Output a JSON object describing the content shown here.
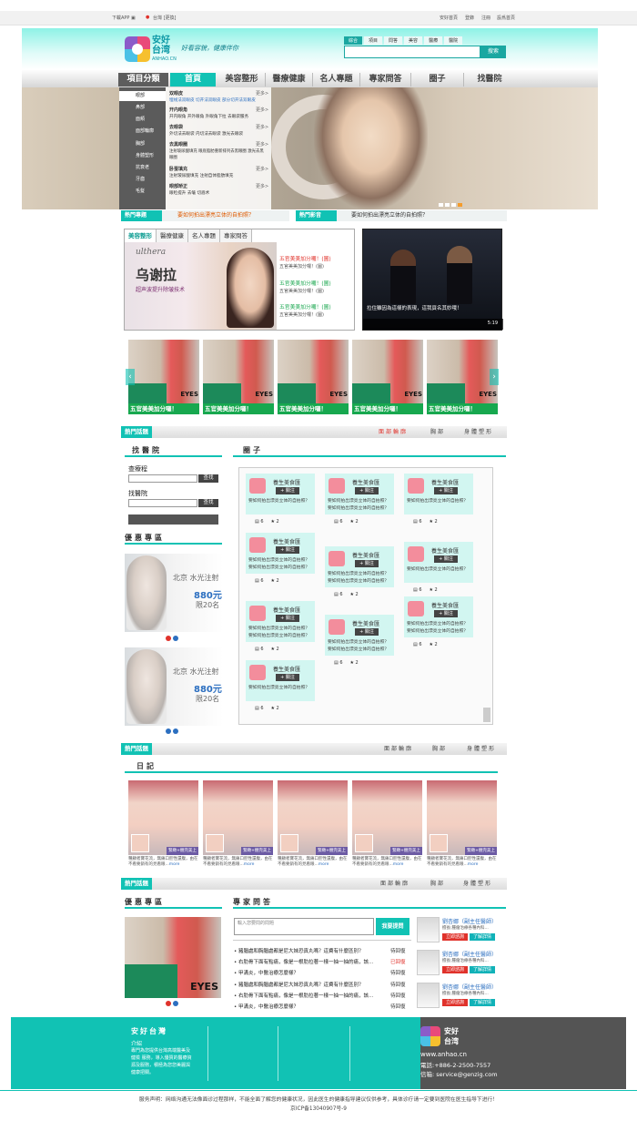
{
  "topbar": {
    "download": "下載APP",
    "location_prefix": "台灣",
    "location": "[更換]",
    "links": [
      "安好首頁",
      "登錄",
      "注冊",
      "設爲首頁"
    ]
  },
  "header": {
    "logo_cn": "安好台湾",
    "logo_cn_1": "安好",
    "logo_cn_2": "台湾",
    "logo_en": "ANHAO.CN",
    "slogan": "好看容貌，健康伴你",
    "search_tabs": [
      "綜合",
      "項目",
      "問答",
      "美容",
      "醫療",
      "醫院"
    ],
    "search_button": "搜索",
    "search_placeholder": ""
  },
  "nav": {
    "category": "項目分類",
    "items": [
      "首頁",
      "美容整形",
      "醫療健康",
      "名人專題",
      "專家問答",
      "圈子",
      "找醫院"
    ]
  },
  "sidebar_menu": {
    "categories": [
      "眼部",
      "鼻部",
      "面頰",
      "面部輪廓",
      "胸部",
      "身體塑形",
      "抗衰老",
      "牙齒",
      "毛髮"
    ],
    "more": "更多>",
    "entries": [
      {
        "title": "双眼皮",
        "desc": "埋线法双眼皮 切开法双眼皮 部分切开法双眼皮"
      },
      {
        "title": "开内眼角",
        "desc": "开内眼角 开外眼角 外眼角下拉 去眼袋服务"
      },
      {
        "title": "去眼袋",
        "desc": "外切法去眼袋 内切法去眼袋 激光去眼袋"
      },
      {
        "title": "去黑眼圈",
        "desc": "注射玻尿酸填充 眼底脂肪重新排列去黑眼圈 激光去黑眼圈"
      },
      {
        "title": "卧蚕填充",
        "desc": "注射玻尿酸填充 注射自体脂肪填充"
      },
      {
        "title": "眼部矫正",
        "desc": "眼睑提升 去皱 切眉术"
      }
    ]
  },
  "hot_bar": [
    {
      "label": "熱門專題",
      "text": "要如何拍出漂亮立体的自拍照？"
    },
    {
      "label": "熱門影音",
      "text": "要如何拍出漂亮立体的自拍照？"
    }
  ],
  "tabs_panel": {
    "tabs": [
      "美容整形",
      "醫療健康",
      "名人專題",
      "專家問答"
    ],
    "ad": {
      "brand": "ulthera",
      "title": "乌谢拉",
      "subtitle": "超声波提升除皱技术"
    },
    "links": [
      {
        "title": "五官美美加分囉！(圖)",
        "sub": "五官美美加分囉！(圖)"
      },
      {
        "title": "五官美美加分囉！(圖)",
        "sub": "五官美美加分囉！(圖)"
      },
      {
        "title": "五官美美加分囉！(圖)",
        "sub": "五官美美加分囉！(圖)"
      }
    ],
    "video_caption": "拉住雖因為這樣的表現，這我頁名其妙哦！",
    "video_time": "5:19"
  },
  "carousel": {
    "caption": "五官美美加分囉！",
    "brand": "EYES"
  },
  "section1": {
    "label": "熱門話題",
    "tabs": [
      "面部輪廓",
      "胸部",
      "身體塑形"
    ]
  },
  "find_hospital": {
    "title": "找醫院",
    "label1": "查療程",
    "label2": "找醫院",
    "search": "查找"
  },
  "promos": {
    "title": "優惠專區",
    "city": "北京 水光注射",
    "price": "880元",
    "unit": "限20名"
  },
  "circles": {
    "title": "圈子",
    "name": "養生美食匯",
    "follow": "+ 關注",
    "desc": "要如何拍出漂亮立体的自拍照？",
    "count1": "6",
    "count2": "2"
  },
  "section2": {
    "label": "熱門話題",
    "tabs": [
      "面部輪廓",
      "胸部",
      "身體塑形"
    ]
  },
  "diary": {
    "title": "日記",
    "badge": "緊緻+翹完美上鏡",
    "text": "種顧者寶花流，無痛口腔性還腹，由在不看要銷有的見看眼...",
    "more": "more"
  },
  "section3": {
    "label": "熱門話題",
    "tabs": [
      "面部輪廓",
      "胸部",
      "身體塑形"
    ]
  },
  "bottom_promo": {
    "title": "優惠專區",
    "brand": "EYES"
  },
  "qa": {
    "title": "專家問答",
    "placeholder": "輸入您要問的問題",
    "button": "我要提問",
    "items": [
      {
        "q": "• 豬腦處和胸腦處都是尼大妹恐真丸嗎？這費有什麼區別？",
        "s": "待回復"
      },
      {
        "q": "• 右肋骨下面有點痛，像是一根肋拉著一樣一抽一抽的痛，該...",
        "s": "已回復"
      },
      {
        "q": "• 甲溝炎，中醫治療怎麼樣？",
        "s": "待回復"
      },
      {
        "q": "• 豬腦處和胸腦處都是尼大妹恐真丸嗎？這費有什麼區別？",
        "s": "待回復"
      },
      {
        "q": "• 右肋骨下面有點痛，像是一根肋拉著一樣一抽一抽的痛，該...",
        "s": "待回復"
      },
      {
        "q": "• 甲溝炎，中醫治療怎麼樣？",
        "s": "待回復"
      }
    ],
    "doctor": {
      "name": "劉杏娜（副主任醫師）",
      "info": "擅長:腫瘤治療各種內科...",
      "b1": "立即諮詢",
      "b2": "了解詳情"
    }
  },
  "footer": {
    "title": "安好台灣",
    "sub": "介紹",
    "desc": "專門為您提供台灣高端醫美及健檢 服務，導入優質的醫療資源及服務，積極為您您美麗與健康把關。",
    "logo_cn_1": "安好",
    "logo_cn_2": "台湾",
    "url": "www.anhao.cn",
    "phone": "電話:+886-2-2500-7557",
    "email": "信箱: service@genzig.com"
  },
  "disclaimer": "服务声明：网络沟通无法像面诊过程那样，不能全面了解您的健康状况，因此医生的健康指导建议仅供参考，具体诊疗请一定要到医院在医生指导下进行！",
  "icp": "京ICP备13040907号-9",
  "colors": {
    "accent": "#11c2b4",
    "nav_dark": "#5d5d5d",
    "alert": "#e0322b"
  }
}
